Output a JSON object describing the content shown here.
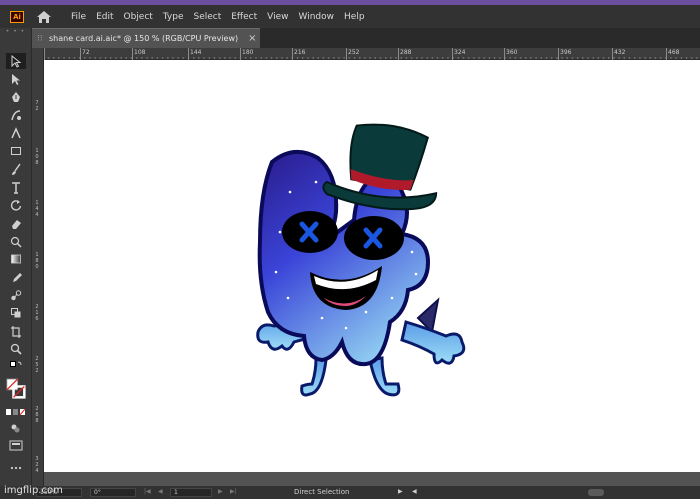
{
  "app": {
    "logo_text": "Ai",
    "accent_color": "#6b4f9e"
  },
  "menu": {
    "items": [
      "File",
      "Edit",
      "Object",
      "Type",
      "Select",
      "Effect",
      "View",
      "Window",
      "Help"
    ]
  },
  "document_tab": {
    "title": "shane card.ai.aic* @ 150 % (RGB/CPU Preview)",
    "close_glyph": "×"
  },
  "rulers": {
    "horizontal_ticks": [
      "72",
      "108",
      "144",
      "180",
      "216",
      "252",
      "288",
      "324",
      "360",
      "396",
      "432",
      "468"
    ],
    "vertical_ticks": [
      "7\n2",
      "1\n0\n8",
      "1\n4\n4",
      "1\n8\n0",
      "2\n1\n6",
      "2\n5\n2",
      "2\n8\n8",
      "3\n2\n4"
    ]
  },
  "tools": [
    "selection-tool",
    "direct-selection-tool",
    "pen-tool",
    "curvature-tool",
    "type-tool-alt",
    "rectangle-tool",
    "paintbrush-tool",
    "type-tool",
    "rotate-tool",
    "eraser-tool",
    "warp-tool",
    "gradient-tool",
    "eyedropper-tool",
    "blend-tool",
    "shape-builder-tool",
    "artboard-tool",
    "zoom-tool"
  ],
  "statusbar": {
    "zoom": "150%",
    "rotation": "0°",
    "artboard_number": "1",
    "current_tool": "Direct Selection"
  },
  "watermark": "imgflip.com"
}
